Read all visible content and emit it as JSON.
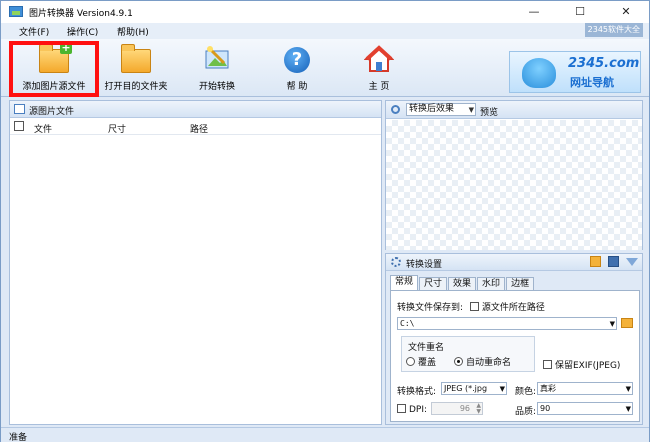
{
  "window": {
    "title": "图片转换器 Version4.9.1",
    "controls": {
      "minimize": "—",
      "maximize": "☐",
      "close": "✕"
    }
  },
  "menu": {
    "items": [
      "文件(F)",
      "操作(C)",
      "帮助(H)"
    ],
    "right_text": "2345软件大全"
  },
  "toolbar": {
    "add_source": "添加图片源文件",
    "open_target": "打开目的文件夹",
    "start_convert": "开始转换",
    "help": "帮 助",
    "home": "主 页"
  },
  "ad": {
    "big": "2345.com",
    "small": "网址导航"
  },
  "source_panel": {
    "title": "源图片文件",
    "columns": [
      "文件",
      "尺寸",
      "路径"
    ]
  },
  "preview": {
    "mode_selected": "转换后效果",
    "label": "预览"
  },
  "settings": {
    "title": "转换设置",
    "tabs": [
      "常规",
      "尺寸",
      "效果",
      "水印",
      "边框"
    ],
    "active_tab": "常规",
    "save_to_label": "转换文件保存到:",
    "source_path_label": "源文件所在路径",
    "path_value": "C:\\",
    "rename_group": "文件重名",
    "overwrite": "覆盖",
    "auto_rename": "自动重命名",
    "keep_exif": "保留EXIF(JPEG)",
    "format_label": "转换格式:",
    "format_value": "JPEG (*.jpg",
    "color_label": "颜色:",
    "color_value": "真彩",
    "dpi_label": "DPI:",
    "dpi_value": "96",
    "quality_label": "品质:",
    "quality_value": "90"
  },
  "status": {
    "text": "准备"
  },
  "colors": {
    "highlight": "#ff1010",
    "accent": "#1b6fd1",
    "panel": "#dfe9f6"
  }
}
